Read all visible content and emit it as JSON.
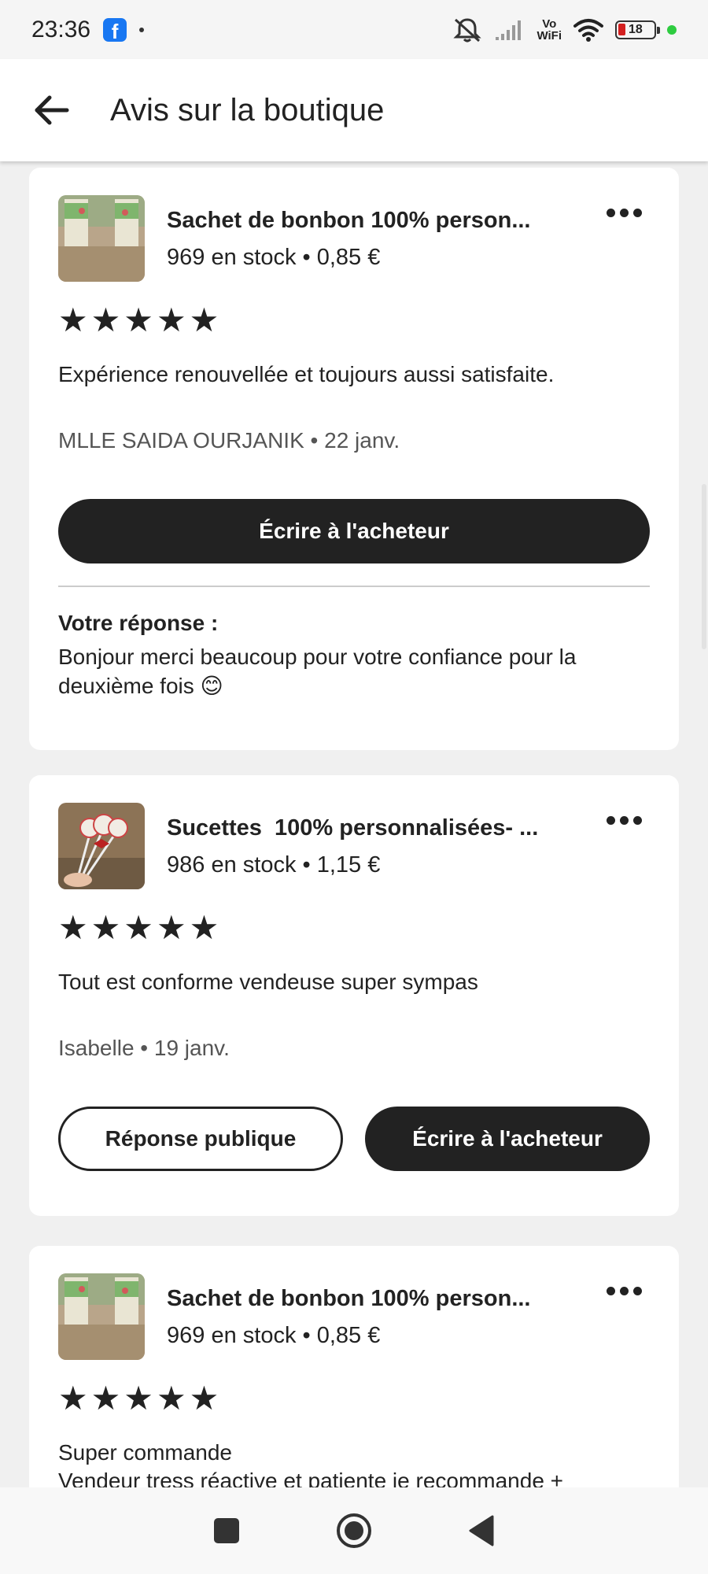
{
  "status_bar": {
    "time": "23:36",
    "vowifi_top": "Vo",
    "vowifi_bottom": "WiFi",
    "battery": "18"
  },
  "header": {
    "title": "Avis sur la boutique"
  },
  "reviews": [
    {
      "listing_title": "Sachet de bonbon 100% person...",
      "listing_meta": "969 en stock • 0,85 €",
      "rating": 5,
      "stars": "★★★★★",
      "text": "Expérience renouvellée et toujours aussi satisfaite.",
      "reviewer": "MLLE SAIDA OURJANIK • 22 janv.",
      "write_button": "Écrire à l'acheteur",
      "response_label": "Votre réponse :",
      "response_text": "Bonjour merci beaucoup pour votre confiance pour la deuxième fois 😊"
    },
    {
      "listing_title": "Sucettes  100% personnalisées- ...",
      "listing_meta": "986 en stock • 1,15 €",
      "rating": 5,
      "stars": "★★★★★",
      "text": "Tout est conforme vendeuse super sympas",
      "reviewer": "Isabelle • 19 janv.",
      "public_reply_button": "Réponse publique",
      "write_button": "Écrire à l'acheteur"
    },
    {
      "listing_title": "Sachet de bonbon 100% person...",
      "listing_meta": "969 en stock • 0,85 €",
      "rating": 5,
      "stars": "★★★★★",
      "text_line1": "Super commande",
      "text_line2": "Vendeur tress réactive et patiente je recommande +"
    }
  ],
  "colors": {
    "button_dark": "#222222",
    "background": "#f0f0f0",
    "facebook": "#1877f2",
    "battery_low": "#d32020",
    "status_dot": "#2ecc40"
  }
}
